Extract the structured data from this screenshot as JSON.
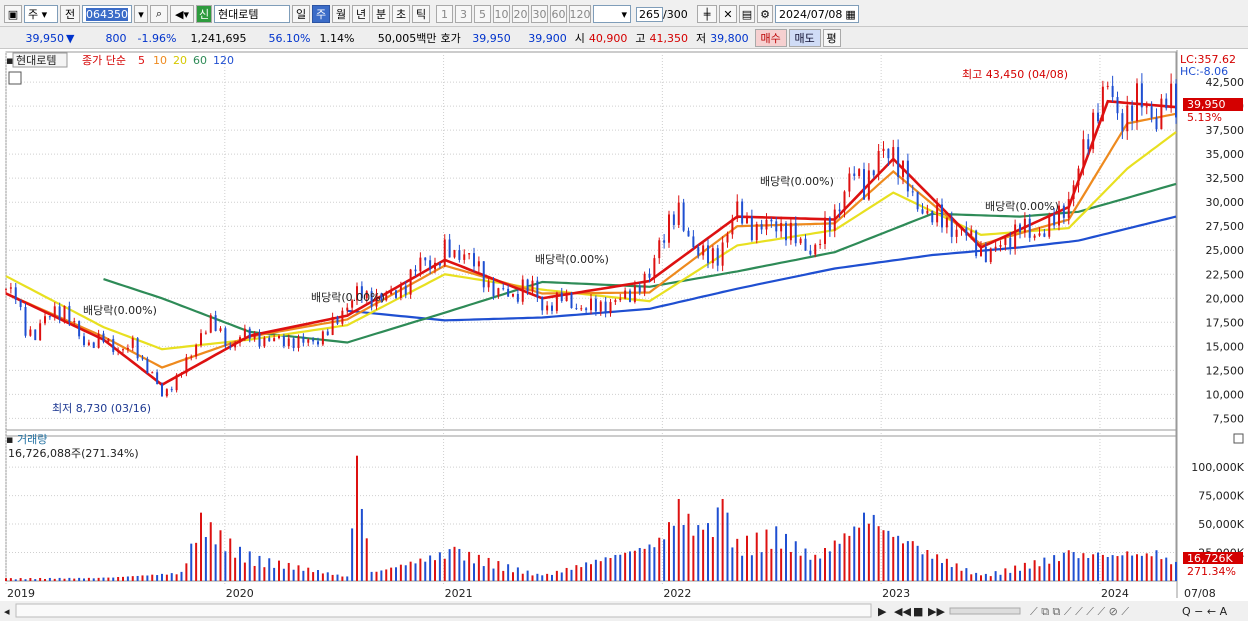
{
  "toolbar": {
    "market": "주",
    "prev_label": "전",
    "code": "064350",
    "badge": "신",
    "stock_name": "현대로템",
    "periods": [
      "일",
      "주",
      "월",
      "년",
      "분",
      "초",
      "틱"
    ],
    "selected_period": "주",
    "minute_values": [
      "1",
      "3",
      "5",
      "10",
      "20",
      "30",
      "60",
      "120"
    ],
    "count": "265",
    "count_total": "/300",
    "date": "2024/07/08"
  },
  "quote": {
    "price": "39,950",
    "change_arrow": "▼",
    "change": "800",
    "change_pct": "-1.96%",
    "volume": "1,241,695",
    "vol_ratio": "56.10%",
    "turnover_pct": "1.14%",
    "amount": "50,005백만",
    "hoga_label": "호가",
    "ask": "39,950",
    "bid": "39,900",
    "open_label": "시",
    "open": "40,900",
    "high_label": "고",
    "high": "41,350",
    "low_label": "저",
    "low": "39,800",
    "buy_label": "매수",
    "sell_label": "매도",
    "eval_label": "평"
  },
  "legend": {
    "name": "현대로템",
    "type": "종가 단순",
    "ma": [
      {
        "label": "5",
        "color": "#dd1111"
      },
      {
        "label": "10",
        "color": "#ee8a1e"
      },
      {
        "label": "20",
        "color": "#e6dc20"
      },
      {
        "label": "60",
        "color": "#2e8b57"
      },
      {
        "label": "120",
        "color": "#1f4fd1"
      }
    ]
  },
  "right_panel": {
    "lc": "LC:357.62",
    "hc": "HC:-8.06",
    "current_price": "39,950",
    "current_pct": "5.13%",
    "vol_current": "16,726K",
    "vol_pct": "271.34%"
  },
  "annotations": {
    "max_label": "최고 43,450 (04/08)",
    "min_label": "최저 8,730 (03/16)",
    "dividend": "배당락(0.00%)"
  },
  "volume_panel": {
    "title": "거래량",
    "value": "16,726,088주(271.34%)"
  },
  "colors": {
    "up": "#dd1111",
    "down": "#1f4fd1",
    "grid": "#d0d0d0"
  },
  "chart_data": {
    "type": "candlestick",
    "x_labels": [
      "2019",
      "2020",
      "2021",
      "2022",
      "2023",
      "2024",
      "07/08"
    ],
    "y_ticks": [
      42500,
      40000,
      37500,
      35000,
      32500,
      30000,
      27500,
      25000,
      22500,
      20000,
      17500,
      15000,
      12500,
      10000,
      7500
    ],
    "y_tick_labels": [
      "42,500",
      "40,000",
      "37,500",
      "35,000",
      "32,500",
      "30,000",
      "27,500",
      "25,000",
      "22,500",
      "20,000",
      "17,500",
      "15,000",
      "12,500",
      "10,000",
      "7,500"
    ],
    "ylim": [
      6500,
      44800
    ],
    "volume_ticks": [
      100000,
      75000,
      50000,
      25000
    ],
    "volume_tick_labels": [
      "100,000K",
      "75,000K",
      "50,000K",
      "25,000K"
    ],
    "volume_ylim": [
      0,
      115000
    ],
    "close_path": [
      [
        0,
        21000
      ],
      [
        4,
        20000
      ],
      [
        8,
        17000
      ],
      [
        12,
        16000
      ],
      [
        16,
        17800
      ],
      [
        20,
        19000
      ],
      [
        24,
        18500
      ],
      [
        28,
        17000
      ],
      [
        32,
        15500
      ],
      [
        36,
        15200
      ],
      [
        40,
        15800
      ],
      [
        44,
        15000
      ],
      [
        48,
        14500
      ],
      [
        52,
        15200
      ],
      [
        56,
        13500
      ],
      [
        60,
        12000
      ],
      [
        64,
        9800
      ],
      [
        68,
        11000
      ],
      [
        72,
        12500
      ],
      [
        76,
        14000
      ],
      [
        80,
        16500
      ],
      [
        84,
        17500
      ],
      [
        88,
        16200
      ],
      [
        92,
        15000
      ],
      [
        96,
        16000
      ],
      [
        100,
        16200
      ],
      [
        104,
        15800
      ],
      [
        108,
        15500
      ],
      [
        112,
        15700
      ],
      [
        116,
        15600
      ],
      [
        120,
        15300
      ],
      [
        124,
        15500
      ],
      [
        128,
        15800
      ],
      [
        132,
        16500
      ],
      [
        136,
        17800
      ],
      [
        140,
        19500
      ],
      [
        144,
        20500
      ],
      [
        148,
        20000
      ],
      [
        152,
        20300
      ],
      [
        156,
        20000
      ],
      [
        160,
        20500
      ],
      [
        164,
        21500
      ],
      [
        168,
        23000
      ],
      [
        172,
        24000
      ],
      [
        176,
        23500
      ],
      [
        180,
        24800
      ],
      [
        184,
        24500
      ],
      [
        188,
        25000
      ],
      [
        192,
        23500
      ],
      [
        196,
        22000
      ],
      [
        200,
        21000
      ],
      [
        204,
        20500
      ],
      [
        208,
        20000
      ],
      [
        212,
        21500
      ],
      [
        216,
        21000
      ],
      [
        220,
        19000
      ],
      [
        224,
        19500
      ],
      [
        228,
        20000
      ],
      [
        232,
        19500
      ],
      [
        236,
        19000
      ],
      [
        240,
        19000
      ],
      [
        244,
        19200
      ],
      [
        248,
        19500
      ],
      [
        252,
        19800
      ],
      [
        256,
        20500
      ],
      [
        260,
        21500
      ],
      [
        264,
        22000
      ],
      [
        268,
        26000
      ],
      [
        272,
        28000
      ],
      [
        276,
        28500
      ],
      [
        280,
        26500
      ],
      [
        284,
        25000
      ],
      [
        288,
        24000
      ],
      [
        292,
        24500
      ],
      [
        296,
        27000
      ],
      [
        300,
        29000
      ],
      [
        304,
        28000
      ],
      [
        308,
        27000
      ],
      [
        312,
        27500
      ],
      [
        316,
        28000
      ],
      [
        320,
        27000
      ],
      [
        324,
        26000
      ],
      [
        328,
        25500
      ],
      [
        332,
        25000
      ],
      [
        336,
        27000
      ],
      [
        340,
        29000
      ],
      [
        344,
        31000
      ],
      [
        348,
        33000
      ],
      [
        352,
        32000
      ],
      [
        356,
        33500
      ],
      [
        360,
        35000
      ],
      [
        364,
        35500
      ],
      [
        368,
        33000
      ],
      [
        372,
        30000
      ],
      [
        376,
        29500
      ],
      [
        380,
        28500
      ],
      [
        384,
        28000
      ],
      [
        388,
        27500
      ],
      [
        392,
        27000
      ],
      [
        396,
        26000
      ],
      [
        400,
        25000
      ],
      [
        404,
        24500
      ],
      [
        408,
        25500
      ],
      [
        412,
        26500
      ],
      [
        416,
        27500
      ],
      [
        420,
        26500
      ],
      [
        424,
        27000
      ],
      [
        428,
        27500
      ],
      [
        432,
        28500
      ],
      [
        436,
        30500
      ],
      [
        440,
        33500
      ],
      [
        444,
        36500
      ],
      [
        448,
        40500
      ],
      [
        452,
        42000
      ],
      [
        456,
        38500
      ],
      [
        460,
        39500
      ],
      [
        464,
        40500
      ],
      [
        468,
        39500
      ],
      [
        472,
        39000
      ],
      [
        476,
        40500
      ],
      [
        480,
        39950
      ]
    ],
    "ma": {
      "5": [
        [
          0,
          20500
        ],
        [
          40,
          15700
        ],
        [
          64,
          11000
        ],
        [
          100,
          16100
        ],
        [
          140,
          18200
        ],
        [
          180,
          24000
        ],
        [
          220,
          20000
        ],
        [
          264,
          21800
        ],
        [
          300,
          28500
        ],
        [
          340,
          28200
        ],
        [
          364,
          34500
        ],
        [
          400,
          25300
        ],
        [
          436,
          29500
        ],
        [
          452,
          40500
        ],
        [
          480,
          39900
        ]
      ],
      "10": [
        [
          0,
          20500
        ],
        [
          40,
          16000
        ],
        [
          64,
          12800
        ],
        [
          100,
          16000
        ],
        [
          140,
          17800
        ],
        [
          180,
          23400
        ],
        [
          220,
          20500
        ],
        [
          264,
          20600
        ],
        [
          300,
          27500
        ],
        [
          340,
          27800
        ],
        [
          364,
          33200
        ],
        [
          400,
          25600
        ],
        [
          436,
          28200
        ],
        [
          460,
          38200
        ],
        [
          480,
          39200
        ]
      ],
      "20": [
        [
          0,
          22300
        ],
        [
          40,
          17000
        ],
        [
          64,
          14700
        ],
        [
          100,
          15700
        ],
        [
          140,
          17200
        ],
        [
          180,
          22500
        ],
        [
          220,
          20900
        ],
        [
          264,
          19700
        ],
        [
          300,
          25500
        ],
        [
          340,
          27100
        ],
        [
          364,
          31000
        ],
        [
          400,
          26600
        ],
        [
          436,
          27300
        ],
        [
          460,
          33500
        ],
        [
          480,
          37300
        ]
      ],
      "60": [
        [
          40,
          22000
        ],
        [
          64,
          20000
        ],
        [
          100,
          16500
        ],
        [
          140,
          15400
        ],
        [
          180,
          18500
        ],
        [
          220,
          21700
        ],
        [
          264,
          21200
        ],
        [
          300,
          22800
        ],
        [
          340,
          24800
        ],
        [
          380,
          28800
        ],
        [
          416,
          28500
        ],
        [
          440,
          29000
        ],
        [
          480,
          31900
        ]
      ],
      "120": [
        [
          140,
          18700
        ],
        [
          180,
          17700
        ],
        [
          220,
          18000
        ],
        [
          264,
          18900
        ],
        [
          300,
          21000
        ],
        [
          340,
          23100
        ],
        [
          380,
          24500
        ],
        [
          416,
          25300
        ],
        [
          440,
          26000
        ],
        [
          480,
          28500
        ]
      ]
    },
    "volume_path": [
      [
        0,
        2500
      ],
      [
        40,
        3000
      ],
      [
        72,
        8000
      ],
      [
        80,
        60000
      ],
      [
        96,
        30000
      ],
      [
        104,
        22000
      ],
      [
        140,
        4000
      ],
      [
        144,
        110000
      ],
      [
        150,
        8000
      ],
      [
        184,
        30000
      ],
      [
        220,
        5000
      ],
      [
        268,
        38000
      ],
      [
        276,
        72000
      ],
      [
        286,
        45000
      ],
      [
        294,
        72000
      ],
      [
        300,
        37000
      ],
      [
        316,
        48000
      ],
      [
        332,
        23000
      ],
      [
        352,
        60000
      ],
      [
        356,
        58000
      ],
      [
        372,
        35000
      ],
      [
        400,
        5000
      ],
      [
        436,
        27000
      ],
      [
        448,
        25000
      ],
      [
        460,
        26000
      ],
      [
        472,
        27000
      ],
      [
        480,
        16726
      ]
    ]
  }
}
